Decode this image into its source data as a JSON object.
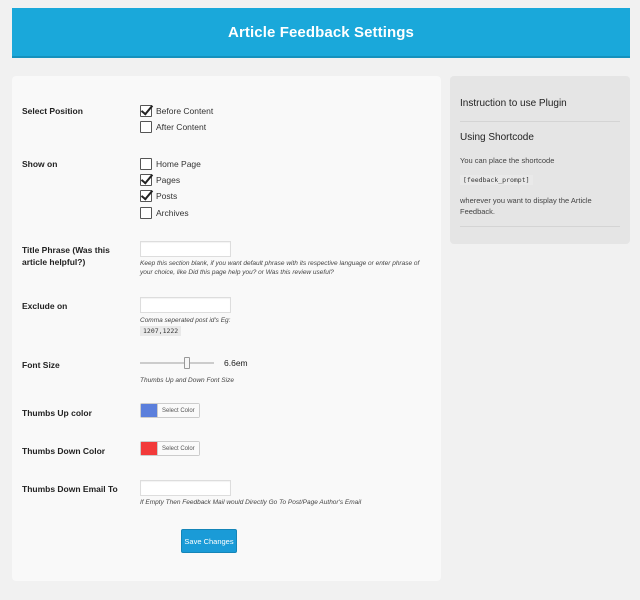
{
  "header": {
    "title": "Article Feedback Settings"
  },
  "form": {
    "position": {
      "label": "Select Position",
      "options": [
        {
          "label": "Before Content",
          "checked": true
        },
        {
          "label": "After Content",
          "checked": false
        }
      ]
    },
    "show_on": {
      "label": "Show on",
      "options": [
        {
          "label": "Home Page",
          "checked": false
        },
        {
          "label": "Pages",
          "checked": true
        },
        {
          "label": "Posts",
          "checked": true
        },
        {
          "label": "Archives",
          "checked": false
        }
      ]
    },
    "title_phrase": {
      "label": "Title Phrase (Was this article helpful?)",
      "value": "",
      "hint": "Keep this section blank, if you want default phrase with its respective language or enter phrase of your choice, like Did this page help you? or Was this review useful?"
    },
    "exclude_on": {
      "label": "Exclude on",
      "value": "",
      "hint": "Comma seperated post id's Eg:",
      "example": "1207,1222"
    },
    "font_size": {
      "label": "Font Size",
      "value": "6.6em",
      "hint": "Thumbs Up and Down Font Size"
    },
    "thumbs_up_color": {
      "label": "Thumbs Up color",
      "color": "#5b7fdc",
      "button_label": "Select Color"
    },
    "thumbs_down_color": {
      "label": "Thumbs Down Color",
      "color": "#f23a3a",
      "button_label": "Select Color"
    },
    "thumbs_down_email": {
      "label": "Thumbs Down Email To",
      "value": "",
      "hint": "If Empty Then Feedback Mail would Directly Go To Post/Page Author's Email"
    },
    "save_label": "Save Changes"
  },
  "sidebar": {
    "title": "Instruction to use Plugin",
    "subtitle": "Using Shortcode",
    "text1": "You can place the shortcode",
    "shortcode": "[feedback_prompt]",
    "text2": "wherever you want to display the Article Feedback."
  }
}
